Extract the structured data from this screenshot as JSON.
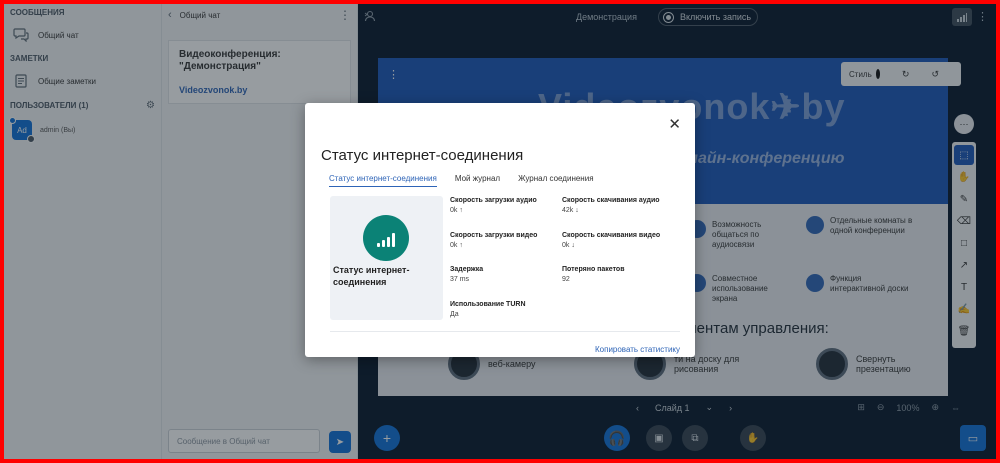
{
  "sidebar": {
    "messages_title": "СООБЩЕНИЯ",
    "public_chat": "Общий чат",
    "notes_title": "ЗАМЕТКИ",
    "shared_notes": "Общие заметки",
    "users_title": "ПОЛЬЗОВАТЕЛИ (1)",
    "user_avatar": "Ad",
    "user_name": "admin (Вы)"
  },
  "chat": {
    "header": "Общий чат",
    "welcome_title": "Видеоконференция: \"Демонстрация\"",
    "welcome_link": "Videozvonok.by",
    "input_placeholder": "Сообщение в Общий чат"
  },
  "topbar": {
    "meeting_title": "Демонстрация",
    "record_label": "Включить запись"
  },
  "slide": {
    "logo": "Videozvonok✈by",
    "subtitle": "лайн-конференцию",
    "style_label": "Стиль",
    "features": [
      "Возможность общаться по аудиосвязи",
      "Отдельные комнаты в одной конференции",
      "Совместное использование экрана",
      "Функция интерактивной доски"
    ],
    "controls_title": "ементам управления:",
    "bottom_items": [
      "веб-камеру",
      "ти на доску для рисования",
      "Свернуть презентацию"
    ],
    "slide_label": "Слайд 1",
    "zoom": "100%"
  },
  "modal": {
    "title": "Статус интернет-соединения",
    "tabs": [
      "Статус интернет-соединения",
      "Мой журнал",
      "Журнал соединения"
    ],
    "card_label": "Статус интернет-соединения",
    "stats": {
      "upload_audio_label": "Скорость загрузки аудио",
      "upload_audio_value": "0k ↑",
      "download_audio_label": "Скорость скачивания аудио",
      "download_audio_value": "42k ↓",
      "upload_video_label": "Скорость загрузки видео",
      "upload_video_value": "0k ↑",
      "download_video_label": "Скорость скачивания видео",
      "download_video_value": "0k ↓",
      "latency_label": "Задержка",
      "latency_value": "37 ms",
      "packets_lost_label": "Потеряно пакетов",
      "packets_lost_value": "92",
      "turn_label": "Использование TURN",
      "turn_value": "Да"
    },
    "copy_label": "Копировать статистику"
  },
  "colors": {
    "accent": "#0f70d7",
    "status_green": "#0b8276",
    "border_red": "#ff0000"
  }
}
